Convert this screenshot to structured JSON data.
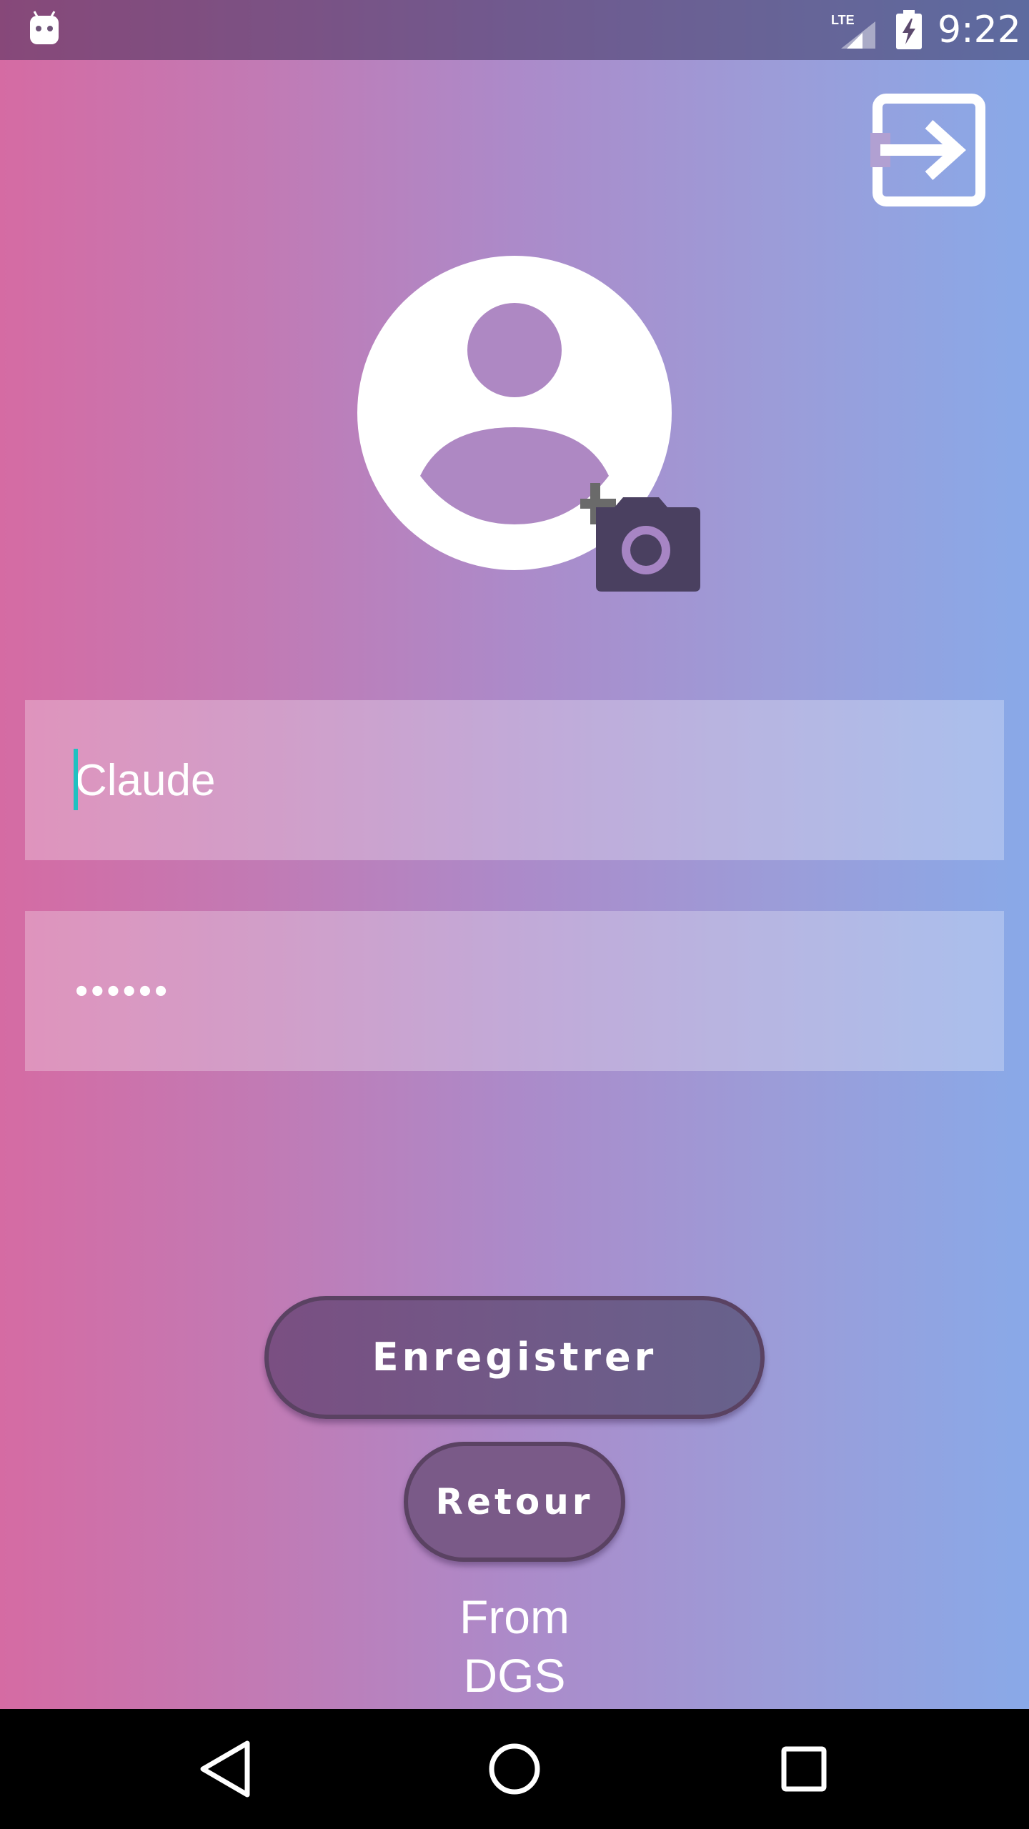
{
  "status_bar": {
    "time": "9:22",
    "network_label": "LTE",
    "icons": [
      "android-icon",
      "lte-signal-icon",
      "battery-charging-icon"
    ]
  },
  "header": {
    "logout_icon": "exit-to-app-icon"
  },
  "profile": {
    "avatar_icon": "account-circle-icon",
    "add_photo_icon": "add-a-photo-icon"
  },
  "form": {
    "name_value": "Claude",
    "password_value": "••••••"
  },
  "actions": {
    "save_label": "Enregistrer",
    "back_label": "Retour"
  },
  "footer": {
    "credit_line1": "From",
    "credit_line2": "DGS"
  },
  "navigation": {
    "icons": [
      "nav-back-icon",
      "nav-home-icon",
      "nav-recents-icon"
    ]
  },
  "colors": {
    "gradient_left": "#d56ba3",
    "gradient_right": "#89a9e8",
    "button_fill": "#735a86",
    "caret": "#1fc1c1",
    "camera_icon": "#4a4060"
  }
}
